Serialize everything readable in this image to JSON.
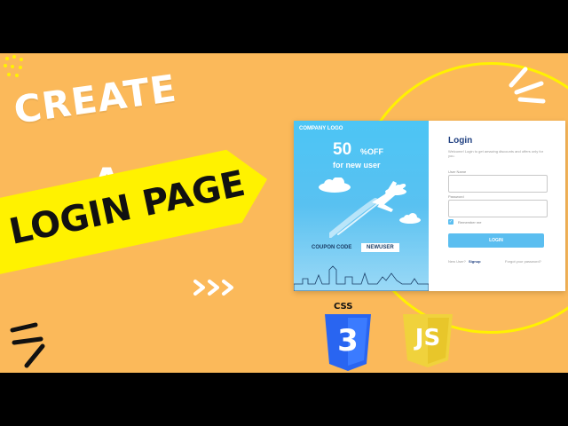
{
  "headline": {
    "line1": "CREATE",
    "line2": "A",
    "banner": "LOGIN PAGE"
  },
  "login_card": {
    "promo": {
      "company_logo": "COMPANY LOGO",
      "discount_number": "50",
      "discount_unit": "%OFF",
      "discount_sub": "for new user",
      "coupon_label": "COUPON CODE",
      "coupon_code": "NEWUSER"
    },
    "form": {
      "title": "Login",
      "subtitle": "Welcome! Login to get amazing discounts and offers only for you.",
      "username_label": "User Name",
      "username_value": "",
      "password_label": "Password",
      "password_value": "",
      "remember_label": "Remember me",
      "remember_checked": true,
      "login_button": "LOGIN",
      "new_user_text": "New User?",
      "signup_link": "Signup",
      "forgot_link": "Forgot your password?"
    }
  },
  "tech_logos": {
    "css_label": "CSS",
    "css_number": "3",
    "js_label": "JS"
  },
  "colors": {
    "background": "#fbb95a",
    "accent_yellow": "#fff200",
    "promo_blue": "#4cc5f5",
    "button_blue": "#5bbef0",
    "title_navy": "#1f3f80",
    "css_blue": "#2965f1",
    "js_yellow": "#f0d23c"
  },
  "icons": {
    "plane": "airplane-icon",
    "cloud": "cloud-icon",
    "chevrons": "triple-chevron-icon",
    "check": "checkmark-icon"
  }
}
